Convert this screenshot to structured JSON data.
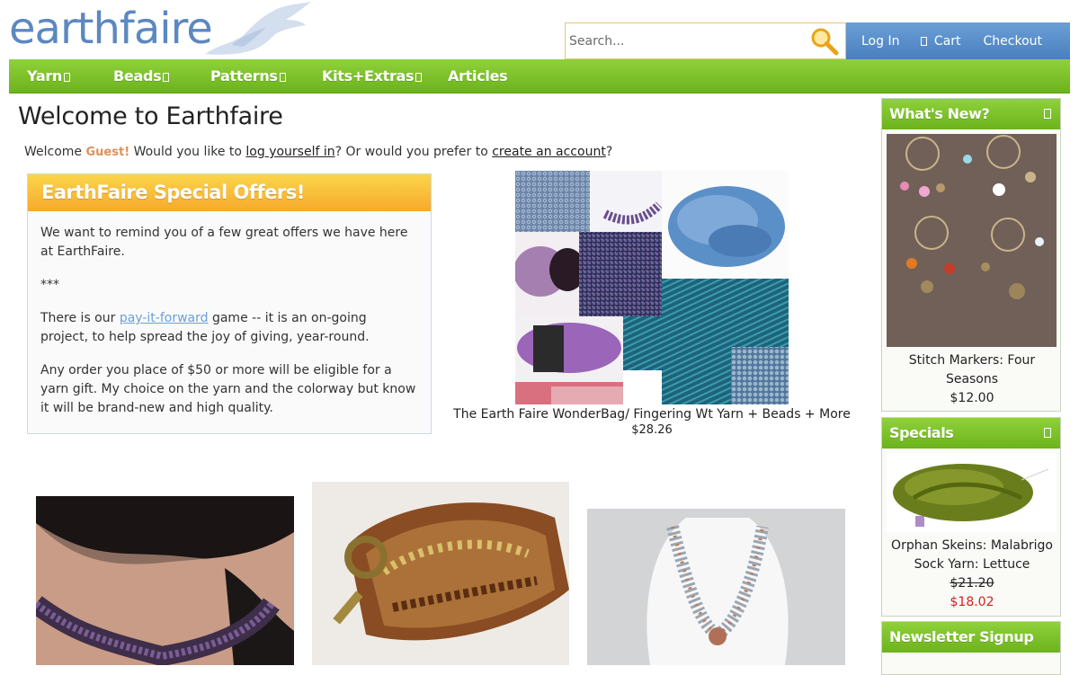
{
  "brand": {
    "logo_text": "earthfaire"
  },
  "search": {
    "placeholder": "Search..."
  },
  "account": {
    "login": "Log In",
    "cart": "Cart",
    "checkout": "Checkout"
  },
  "nav": {
    "items": [
      {
        "label": "Yarn",
        "has_dropdown": true
      },
      {
        "label": "Beads",
        "has_dropdown": true
      },
      {
        "label": "Patterns",
        "has_dropdown": true
      },
      {
        "label": "Kits+Extras",
        "has_dropdown": true
      },
      {
        "label": "Articles",
        "has_dropdown": false
      }
    ]
  },
  "main": {
    "title": "Welcome to Earthfaire",
    "welcome": {
      "prefix": "Welcome",
      "guest": "Guest!",
      "mid": "Would you like to",
      "login_link": "log yourself in",
      "mid2": "? Or would you prefer to",
      "create_link": "create an account",
      "suffix": "?"
    },
    "offers": {
      "heading": "EarthFaire Special Offers!",
      "p1": "We want to remind you of a few great offers we have here at EarthFaire.",
      "p2": "***",
      "p3_before": "There is our",
      "p3_link": "pay-it-forward",
      "p3_after": "game -- it is an on-going project, to help spread the joy of giving, year-round.",
      "p4": "Any order you place of $50 or more will be eligible for a yarn gift. My choice on the yarn and the colorway but know it will be brand-new and high quality."
    },
    "featured": {
      "name": "The Earth Faire WonderBag/ Fingering Wt Yarn + Beads + More",
      "price": "$28.26"
    }
  },
  "sidebar": {
    "whats_new": {
      "heading": "What's New?",
      "product_name": "Stitch Markers: Four Seasons",
      "price": "$12.00"
    },
    "specials": {
      "heading": "Specials",
      "product_name": "Orphan Skeins: Malabrigo Sock Yarn: Lettuce",
      "old_price": "$21.20",
      "sale_price": "$18.02"
    },
    "newsletter": {
      "heading": "Newsletter Signup"
    }
  },
  "colors": {
    "nav_green": "#6cb31d",
    "account_blue": "#4a7fbf",
    "offers_orange": "#f7a92a",
    "sale_red": "#d42020",
    "guest_orange": "#e0905a"
  }
}
